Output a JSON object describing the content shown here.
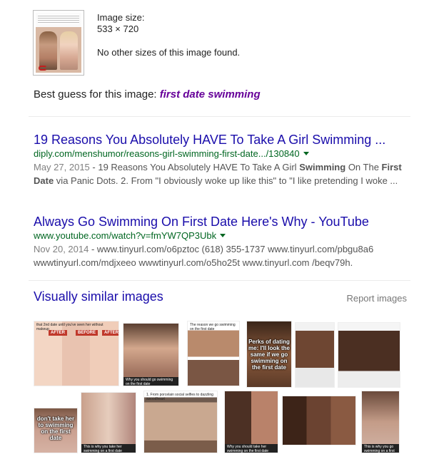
{
  "image_info": {
    "size_label": "Image size:",
    "size_value": "533 × 720",
    "no_other_sizes": "No other sizes of this image found."
  },
  "best_guess": {
    "prefix": "Best guess for this image: ",
    "query": "first date swimming"
  },
  "results": [
    {
      "title": "19 Reasons You Absolutely HAVE To Take A Girl Swimming ...",
      "url": "diply.com/menshumor/reasons-girl-swimming-first-date.../130840",
      "date": "May 27, 2015",
      "snippet_a": " - 19 Reasons You Absolutely HAVE To Take A Girl ",
      "snippet_b1": "Swimming",
      "snippet_c": " On The ",
      "snippet_b2": "First Date",
      "snippet_d": " via Panic Dots. 2. From \"I obviously woke up like this\" to \"I like pretending I woke ..."
    },
    {
      "title": "Always Go Swimming On First Date Here's Why - YouTube",
      "url": "www.youtube.com/watch?v=fmYW7QP3Ubk",
      "date": "Nov 20, 2014",
      "snippet": " - www.tinyurl.com/o6pztoc (618) 355-1737 www.tinyurl.com/pbgu8a6 wwwtinyurl.com/mdjxeeo wwwtinyurl.com/o5ho25t www.tinyurl.com /beqv79h."
    }
  ],
  "similar": {
    "title": "Visually similar images",
    "report": "Report images",
    "images": [
      {
        "caption": "that 2nd date until you've seen her without makeup",
        "tag1": "AFTER",
        "tag2": "BEFORE",
        "tag3": "AFTER"
      },
      {
        "caption": "Why you should go swimming on the first date"
      },
      {
        "caption": "The reason we go swimming on the first date"
      },
      {
        "caption": "Perks of dating me: I'll look the same if we go swimming on the first date"
      },
      {
        "caption": ""
      },
      {
        "caption": ""
      },
      {
        "caption": "don't take her to swimming on the first date"
      },
      {
        "caption": "This is why you take her swimming on a first date"
      },
      {
        "caption": "1. From porcelain social selfies to dazzling swoodheart"
      },
      {
        "caption": "Why you should take her swimming on the first date"
      },
      {
        "caption": ""
      },
      {
        "caption": "This is why you go swimming on a first date"
      }
    ]
  }
}
